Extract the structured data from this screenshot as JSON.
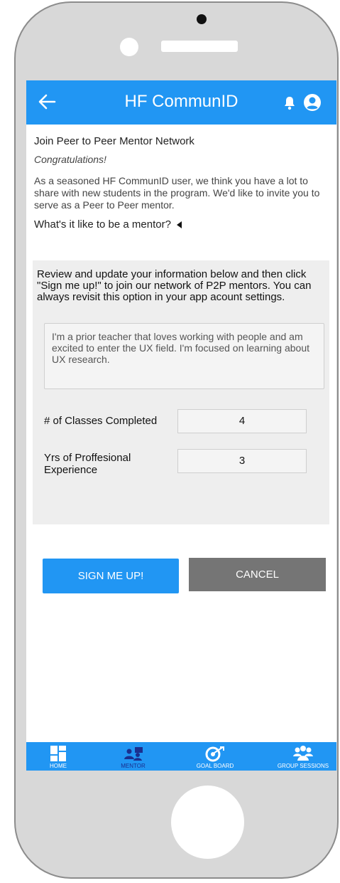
{
  "app": {
    "title": "HF CommunID"
  },
  "page": {
    "join_title": "Join Peer to Peer Mentor Network",
    "congrats": "Congratulations!",
    "intro": "As a seasoned HF CommunID user, we think you have a lot to share with new students in the program. We'd like to invite you to serve as a Peer to Peer mentor.",
    "what_like": "What's it like to be a mentor?"
  },
  "form": {
    "instructions": "Review and update your information below and then click \"Sign me up!\" to join our network of P2P mentors. You can always revisit this option in your app acount settings.",
    "bio": "I'm a prior teacher that loves working with people and am excited to enter the UX field. I'm focused on learning about UX research.",
    "classes_label": "# of Classes Completed",
    "classes_value": "4",
    "experience_label": "Yrs of Proffesional Experience",
    "experience_value": "3",
    "signup_label": "SIGN ME UP!",
    "cancel_label": "CANCEL"
  },
  "nav": {
    "items": [
      {
        "label": "HOME",
        "icon": "home-grid-icon"
      },
      {
        "label": "MENTOR",
        "icon": "mentor-icon",
        "active": true
      },
      {
        "label": "GOAL BOARD",
        "icon": "goal-target-icon"
      },
      {
        "label": "GROUP SESSIONS",
        "icon": "group-icon"
      }
    ]
  },
  "colors": {
    "primary": "#2196f3",
    "active_nav": "#1a2f8f",
    "cancel": "#757575"
  }
}
